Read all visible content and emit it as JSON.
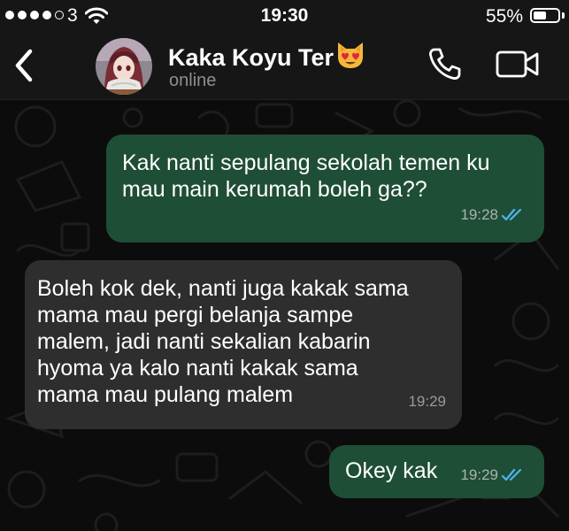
{
  "status_bar": {
    "carrier": "3",
    "time": "19:30",
    "battery_text": "55%",
    "battery_level": 0.55
  },
  "header": {
    "contact_name": "Kaka Koyu Ter",
    "contact_emoji": "heart-eyes-cat-emoji",
    "presence": "online"
  },
  "messages": [
    {
      "direction": "outgoing",
      "text": "Kak nanti sepulang sekolah temen ku\nmau main kerumah boleh ga??",
      "time": "19:28",
      "read": true
    },
    {
      "direction": "incoming",
      "text": "Boleh kok dek, nanti juga kakak sama\nmama mau pergi belanja sampe\nmalem, jadi nanti sekalian kabarin\nhyoma ya kalo nanti kakak sama\nmama mau pulang malem",
      "time": "19:29"
    },
    {
      "direction": "outgoing",
      "text": "Okey kak",
      "time": "19:29",
      "read": true
    }
  ],
  "colors": {
    "outgoing_bubble": "#1f4e36",
    "incoming_bubble": "#2e2e2e",
    "read_tick": "#4fb4f0",
    "background": "#0c0c0c"
  }
}
